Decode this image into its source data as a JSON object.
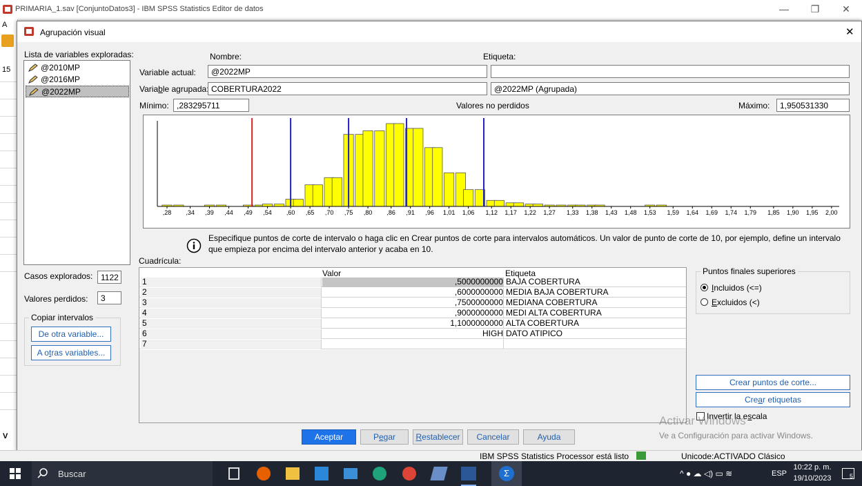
{
  "window": {
    "title": "PRIMARIA_1.sav [ConjuntoDatos3] - IBM SPSS Statistics Editor de datos",
    "minimize": "—",
    "restore": "❐",
    "close": "✕",
    "bg_letters": [
      "A",
      "15",
      "V"
    ]
  },
  "dialog": {
    "title": "Agrupación visual",
    "close": "✕",
    "var_list_label": "Lista de variables exploradas:",
    "variables": [
      "@2010MP",
      "@2016MP",
      "@2022MP"
    ],
    "col_name": "Nombre:",
    "col_label": "Etiqueta:",
    "current_var_label": "Variable actual:",
    "current_var_value": "@2022MP",
    "current_var_tag": "",
    "binned_var_label_pre": "Varia",
    "binned_var_label_u": "b",
    "binned_var_label_post": "le agrupada:",
    "binned_var_value": "COBERTURA2022",
    "binned_var_tag": "@2022MP (Agrupada)",
    "min_label": "Mínimo:",
    "min_value": ",283295711",
    "nonmissing_label": "Valores no perdidos",
    "max_label": "Máximo:",
    "max_value": "1,950531330",
    "info_text": "Especifique puntos de corte de intervalo o haga clic en Crear puntos de corte para intervalos automáticos. Un valor de punto de corte de 10, por ejemplo, define un intervalo que empieza por encima del intervalo anterior y acaba en 10.",
    "grid_label": "Cuadrícula:",
    "grid_col_value": "Valor",
    "grid_col_label": "Etiqueta",
    "grid_rows": [
      {
        "n": "1",
        "value": ",5000000000",
        "label": "BAJA COBERTURA"
      },
      {
        "n": "2",
        "value": ",6000000000",
        "label": "MEDIA BAJA COBERTURA"
      },
      {
        "n": "3",
        "value": ",7500000000",
        "label": "MEDIANA COBERTURA"
      },
      {
        "n": "4",
        "value": ",9000000000",
        "label": "MEDI ALTA COBERTURA"
      },
      {
        "n": "5",
        "value": "1,1000000000",
        "label": "ALTA COBERTURA"
      },
      {
        "n": "6",
        "value": "HIGH",
        "label": "DATO ATIPICO"
      },
      {
        "n": "7",
        "value": "",
        "label": ""
      }
    ],
    "cases_label": "Casos explorados:",
    "cases_value": "1122",
    "missing_label": "Valores perdidos:",
    "missing_value": "3",
    "copy_group": "Copiar intervalos",
    "from_other": "De otra variable...",
    "to_other_pre": "A o",
    "to_other_u": "t",
    "to_other_post": "ras variables...",
    "upper_end_group": "Puntos finales superiores",
    "incl_u": "I",
    "incl_rest": "ncluidos (<=)",
    "excl_u": "E",
    "excl_rest": "xcluidos (<)",
    "make_cuts": "Crear puntos de corte...",
    "make_labels_pre": "Cre",
    "make_labels_u": "a",
    "make_labels_post": "r etiquetas",
    "reverse_scale_pre": "Invertir la e",
    "reverse_scale_u": "s",
    "reverse_scale_post": "cala",
    "ok": "Aceptar",
    "paste_pre": "P",
    "paste_u": "e",
    "paste_post": "gar",
    "reset_u": "R",
    "reset_rest": "establecer",
    "cancel": "Cancelar",
    "help": "Ayuda",
    "watermark1": "Activar Windows",
    "watermark2": "Ve a Configuración para activar Windows."
  },
  "chart_data": {
    "type": "bar",
    "x": [
      0.28,
      0.31,
      0.34,
      0.37,
      0.39,
      0.42,
      0.44,
      0.47,
      0.49,
      0.52,
      0.54,
      0.57,
      0.6,
      0.62,
      0.65,
      0.67,
      0.7,
      0.72,
      0.75,
      0.78,
      0.8,
      0.83,
      0.86,
      0.88,
      0.91,
      0.93,
      0.96,
      0.98,
      1.01,
      1.04,
      1.06,
      1.09,
      1.12,
      1.14,
      1.17,
      1.19,
      1.22,
      1.24,
      1.27,
      1.3,
      1.33,
      1.35,
      1.38,
      1.4,
      1.43,
      1.45,
      1.48,
      1.51,
      1.53,
      1.56,
      1.59,
      1.61,
      1.64,
      1.66,
      1.69,
      1.72,
      1.74,
      1.77,
      1.79,
      1.82,
      1.85,
      1.87,
      1.9,
      1.93,
      1.95
    ],
    "values": [
      1,
      1,
      0,
      0,
      1,
      1,
      0,
      0,
      1,
      1,
      2,
      2,
      6,
      6,
      18,
      18,
      24,
      24,
      60,
      60,
      63,
      63,
      69,
      69,
      65,
      65,
      49,
      49,
      28,
      28,
      14,
      14,
      5,
      5,
      3,
      3,
      2,
      2,
      1,
      1,
      1,
      1,
      1,
      1,
      0,
      0,
      0,
      0,
      1,
      1,
      0,
      0,
      0,
      0,
      0,
      0,
      0,
      0,
      0,
      0,
      0,
      0,
      0,
      0,
      0
    ],
    "tick_labels": [
      ",28",
      ",34",
      ",39",
      ",44",
      ",49",
      ",54",
      ",60",
      ",65",
      ",70",
      ",75",
      ",80",
      ",86",
      ",91",
      ",96",
      "1,01",
      "1,06",
      "1,12",
      "1,17",
      "1,22",
      "1,27",
      "1,33",
      "1,38",
      "1,43",
      "1,48",
      "1,53",
      "1,59",
      "1,64",
      "1,69",
      "1,74",
      "1,79",
      "1,85",
      "1,90",
      "1,95",
      "2,00"
    ],
    "xlim": [
      0.255,
      2.02
    ],
    "cut_lines": [
      {
        "value": 0.5,
        "color": "#e02020"
      },
      {
        "value": 0.6,
        "color": "#2020c8"
      },
      {
        "value": 0.75,
        "color": "#2020c8"
      },
      {
        "value": 0.9,
        "color": "#2020c8"
      },
      {
        "value": 1.1,
        "color": "#2020c8"
      }
    ],
    "bar_color": "#ffff00"
  },
  "status": {
    "processor": "IBM SPSS Statistics Processor está listo",
    "unicode": "Unicode:ACTIVADO  Clásico"
  },
  "taskbar": {
    "search": "Buscar",
    "lang": "ESP",
    "time": "10:22 p. m.",
    "date": "19/10/2023",
    "notif": "5"
  },
  "colors": {
    "accent": "#1e73e8",
    "bar": "#ffff00"
  }
}
